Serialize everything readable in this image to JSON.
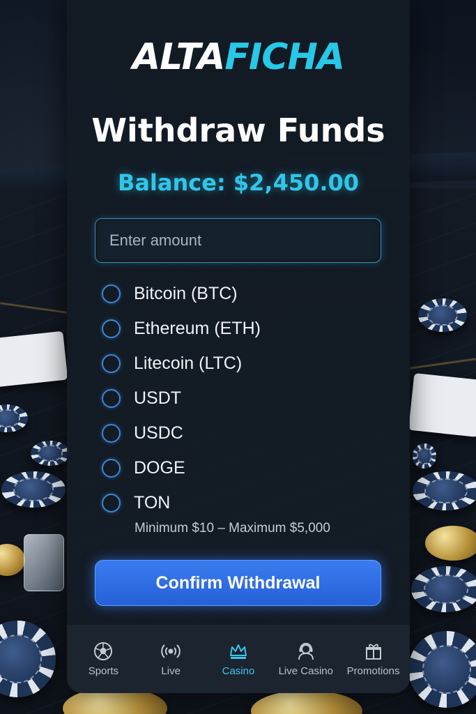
{
  "brand": {
    "part1": "ALTA",
    "part2": "FICHA",
    "accent_color": "#27c8e8"
  },
  "page": {
    "title": "Withdraw Funds",
    "balance": "Balance: $2,450.00"
  },
  "amount_input": {
    "placeholder": "Enter amount",
    "value": ""
  },
  "methods": [
    {
      "label": "Bitcoin (BTC)"
    },
    {
      "label": "Ethereum (ETH)"
    },
    {
      "label": "Litecoin (LTC)"
    },
    {
      "label": "USDT"
    },
    {
      "label": "USDC"
    },
    {
      "label": "DOGE"
    },
    {
      "label": "TON"
    }
  ],
  "limits": "Minimum $10 – Maximum $5,000",
  "confirm_button": {
    "label": "Confirm Withdrawal",
    "color": "#2f6fe6"
  },
  "nav": {
    "items": [
      {
        "label": "Sports",
        "icon": "soccer-ball-icon"
      },
      {
        "label": "Live",
        "icon": "broadcast-icon"
      },
      {
        "label": "Casino",
        "icon": "crown-icon",
        "active": true
      },
      {
        "label": "Live Casino",
        "icon": "dealer-icon"
      },
      {
        "label": "Promotions",
        "icon": "gift-icon"
      }
    ]
  }
}
